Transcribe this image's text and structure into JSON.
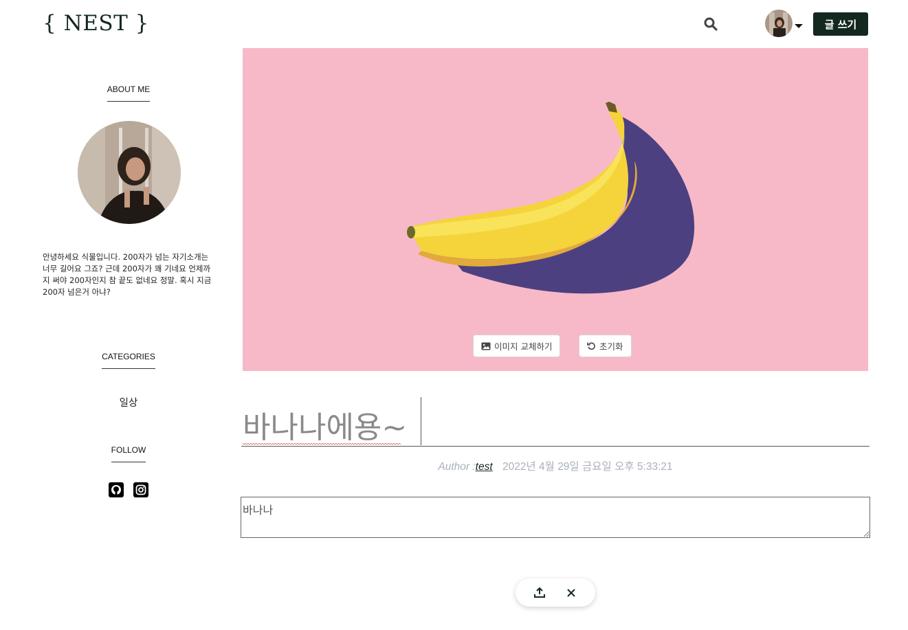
{
  "header": {
    "logo": "{ NEST }",
    "write_label": "글 쓰기",
    "icons": {
      "search": "search-icon",
      "caret": "chevron-down-icon"
    }
  },
  "sidebar": {
    "about_title": "ABOUT ME",
    "bio": "안녕하세요 식물입니다. 200자가 넘는 자기소개는 너무 길어요 그죠? 근데 200자가 꽤 기네요 언제까지 써야 200자인지 참 끝도 없네요 정말. 혹시 지금 200자 넘은거 아냐?",
    "categories_title": "CATEGORIES",
    "categories": [
      "일상"
    ],
    "follow_title": "FOLLOW",
    "social_icons": [
      "github-icon",
      "instagram-icon"
    ]
  },
  "hero": {
    "background_color": "#f7b9c7",
    "replace_label": "이미지 교체하기",
    "reset_label": "초기화",
    "icons": {
      "replace": "image-icon",
      "reset": "undo-icon"
    }
  },
  "post": {
    "title": "바나나에용~",
    "author_label": "Author :",
    "author_name": "test",
    "date": "2022년 4월 29일 금요일 오후 5:33:21",
    "body": "바나나"
  },
  "float_bar": {
    "icons": [
      "upload-icon",
      "close-icon"
    ]
  },
  "colors": {
    "brand": "#13291f",
    "meta": "#aab0bb"
  }
}
